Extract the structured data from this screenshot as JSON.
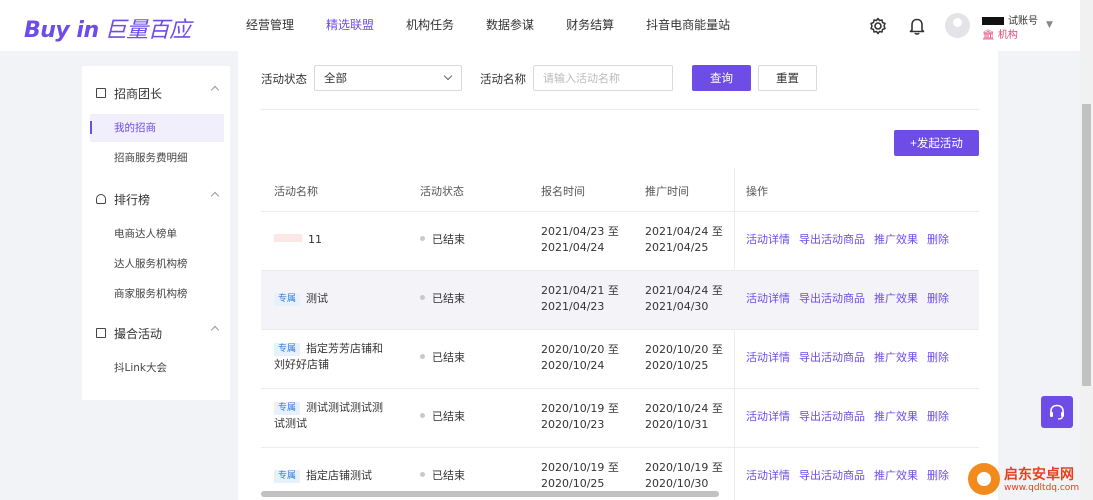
{
  "header": {
    "logo_en": "Buy in",
    "logo_cn": "巨量百应",
    "nav": [
      "经营管理",
      "精选联盟",
      "机构任务",
      "数据参谋",
      "财务结算",
      "抖音电商能量站"
    ],
    "active_nav": "精选联盟",
    "account_name": "试账号",
    "account_type": "机构",
    "icons": [
      "gear-icon",
      "bell-icon",
      "user-avatar-icon",
      "chevron-down-icon"
    ]
  },
  "sidebar": {
    "groups": [
      {
        "label": "招商团长",
        "icon": "briefcase-icon",
        "items": [
          "我的招商",
          "招商服务费明细"
        ]
      },
      {
        "label": "排行榜",
        "icon": "trophy-icon",
        "items": [
          "电商达人榜单",
          "达人服务机构榜",
          "商家服务机构榜"
        ]
      },
      {
        "label": "撮合活动",
        "icon": "match-icon",
        "items": [
          "抖Link大会"
        ]
      }
    ],
    "active_item": "我的招商"
  },
  "filters": {
    "status_label": "活动状态",
    "status_value": "全部",
    "name_label": "活动名称",
    "name_placeholder": "请输入活动名称",
    "search_button": "查询",
    "reset_button": "重置"
  },
  "create_button": "+发起活动",
  "table": {
    "columns": [
      "活动名称",
      "活动状态",
      "报名时间",
      "推广时间",
      "操作"
    ],
    "tag_label": "专属",
    "actions": [
      "活动详情",
      "导出活动商品",
      "推广效果",
      "删除"
    ],
    "rows": [
      {
        "name_lines": [
          "11"
        ],
        "tag": false,
        "redacted_prefix": true,
        "status": "已结束",
        "signup": [
          "2021/04/23 至",
          "2021/04/24"
        ],
        "promo": [
          "2021/04/24 至",
          "2021/04/25"
        ]
      },
      {
        "name_lines": [
          "测试"
        ],
        "tag": true,
        "redacted_prefix": false,
        "status": "已结束",
        "signup": [
          "2021/04/21 至",
          "2021/04/23"
        ],
        "promo": [
          "2021/04/24 至",
          "2021/04/30"
        ]
      },
      {
        "name_lines": [
          "指定芳芳店铺和",
          "刘好好店铺"
        ],
        "tag": true,
        "redacted_prefix": false,
        "status": "已结束",
        "signup": [
          "2020/10/20 至",
          "2020/10/24"
        ],
        "promo": [
          "2020/10/20 至",
          "2020/10/25"
        ]
      },
      {
        "name_lines": [
          "测试测试测试测",
          "试测试"
        ],
        "tag": true,
        "redacted_prefix": false,
        "status": "已结束",
        "signup": [
          "2020/10/19 至",
          "2020/10/23"
        ],
        "promo": [
          "2020/10/24 至",
          "2020/10/31"
        ]
      },
      {
        "name_lines": [
          "指定店铺测试"
        ],
        "tag": true,
        "redacted_prefix": false,
        "status": "已结束",
        "signup": [
          "2020/10/19 至",
          "2020/10/25"
        ],
        "promo": [
          "2020/10/19 至",
          "2020/10/30"
        ]
      }
    ]
  },
  "support_icon": "headset-icon",
  "watermark": {
    "title": "启东安卓网",
    "url": "www.qdltdq.com"
  },
  "colors": {
    "accent": "#6d4de6",
    "tag_bg": "#e8f1fb",
    "tag_text": "#2f7bd8",
    "logo_pink": "#e0457b"
  }
}
